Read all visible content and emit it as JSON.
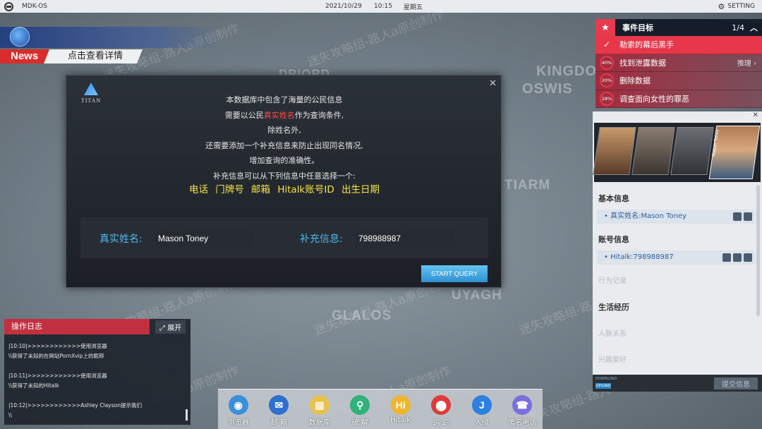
{
  "topbar": {
    "os_name": "MDK-OS",
    "date": "2021/10/29",
    "time": "10:15",
    "weekday": "星期五",
    "setting": "SETTING"
  },
  "news": {
    "tag": "News",
    "link": "点击查看详情"
  },
  "map_labels": [
    "DRIORD",
    "KINGDO",
    "OSWIS",
    "TIARM",
    "UYAGH",
    "GLALOS"
  ],
  "watermark": "迷失攻略组-路人a原创制作",
  "dialog": {
    "logo_name": "TITAN",
    "lines": [
      "本数据库中包含了海量的公民信息",
      "需要以公民",
      "真实姓名",
      "作为查询条件,",
      "除姓名外,",
      "还需要添加一个补充信息来防止出现同名情况,",
      "增加查询的准确性。",
      "补充信息可以从下列信息中任意选择一个:"
    ],
    "options": "电话 门牌号 邮箱 Hitalk账号ID 出生日期",
    "name_label": "真实姓名:",
    "name_value": "Mason Toney",
    "extra_label": "补充信息:",
    "extra_value": "798988987",
    "query_button": "START QUERY",
    "close": "✕"
  },
  "objectives": {
    "title": "事件目标",
    "count": "1/4",
    "items": [
      {
        "status": "done",
        "pct": "",
        "text": "勒索的幕后黑手",
        "hint": ""
      },
      {
        "status": "open",
        "pct": "40%",
        "text": "找到泄露数据",
        "hint": "推理"
      },
      {
        "status": "open",
        "pct": "20%",
        "text": "删除数据",
        "hint": ""
      },
      {
        "status": "open",
        "pct": "28%",
        "text": "调查面向女性的罪恶",
        "hint": ""
      }
    ]
  },
  "profile": {
    "selected_name": "Mason Toney",
    "basic_title": "基本信息",
    "basic_entry": "真实姓名:Mason Toney",
    "account_title": "账号信息",
    "account_entry": "Hitalk:798988987",
    "behavior": "行为记录",
    "life_title": "生活经历",
    "relations": "人脉关系",
    "hobbies": "兴趣爱好",
    "download": "DOWNLOAD",
    "upload": "UPLOAD",
    "submit": "提交信息"
  },
  "log": {
    "title": "操作日志",
    "expand": "展开",
    "entries": [
      "|10:10|>>>>>>>>>>>>使用浏览器",
      "\\\\获得了未知的在网站PornXvip上的昵称",
      "|10:11|>>>>>>>>>>>>使用浏览器",
      "\\\\获得了未知的Hitalk",
      "|10:12|>>>>>>>>>>>>Ashley Clayson提示我们",
      "\\\\"
    ]
  },
  "dock": [
    {
      "label": "浏览器",
      "icon": "globe-icon",
      "color": "#3a8fd8",
      "glyph": "◉"
    },
    {
      "label": "邮 箱",
      "icon": "mail-icon",
      "color": "#2f6fd0",
      "glyph": "✉"
    },
    {
      "label": "数据库",
      "icon": "database-icon",
      "color": "#e8c24a",
      "glyph": "▤"
    },
    {
      "label": "破 解",
      "icon": "crack-icon",
      "color": "#2fb37a",
      "glyph": "⚲"
    },
    {
      "label": "Hitalk",
      "icon": "hitalk-icon",
      "color": "#f0b52e",
      "glyph": "Hi"
    },
    {
      "label": "追 踪",
      "icon": "location-pin-icon",
      "color": "#e03b3b",
      "glyph": "⬤"
    },
    {
      "label": "入侵",
      "icon": "hook-icon",
      "color": "#2d7fe0",
      "glyph": "J"
    },
    {
      "label": "匿名电话",
      "icon": "phone-icon",
      "color": "#7b6fe0",
      "glyph": "☎"
    }
  ]
}
